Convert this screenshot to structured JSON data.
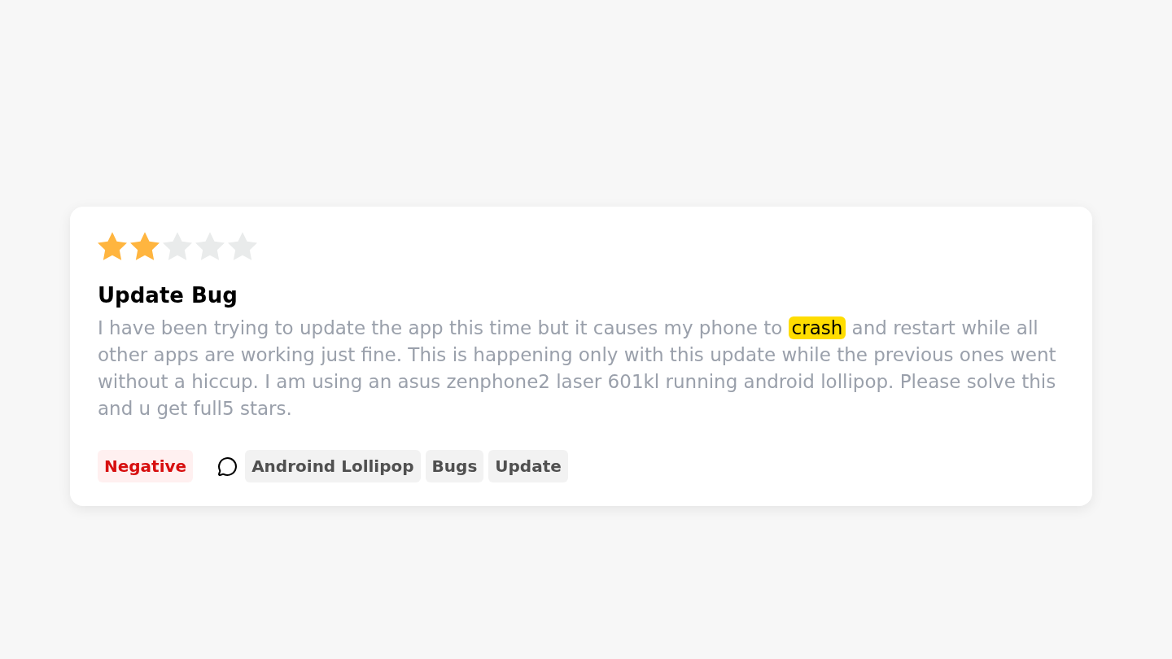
{
  "review": {
    "stars": 2,
    "title": "Update Bug",
    "body": [
      {
        "text": "I have been trying to update the app this time but it causes my phone to ",
        "highlighted": false
      },
      {
        "text": "crash",
        "highlighted": true
      },
      {
        "text": " and restart while all other apps are working just fine. This is happening only with this update while the previous ones went without a hiccup. I am using an asus zenphone2 laser 601kl running android lollipop. Please solve this and u get full5 stars.",
        "highlighted": false
      }
    ],
    "sentiment": {
      "label": "Negative",
      "kind": "negative"
    },
    "topics": [
      "Androind Lollipop",
      "Bugs",
      "Update"
    ]
  }
}
